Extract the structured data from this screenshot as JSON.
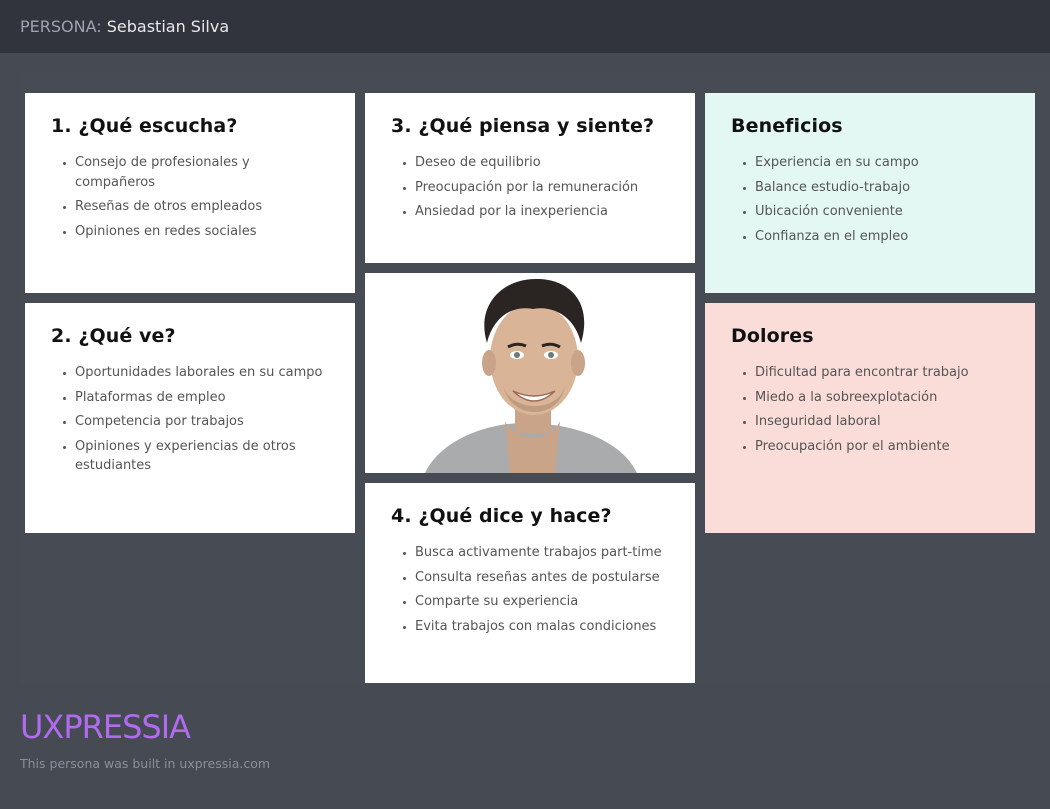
{
  "header": {
    "label": "PERSONA:",
    "name": "Sebastian Silva"
  },
  "cards": {
    "hears": {
      "title": "1. ¿Qué escucha?",
      "items": [
        "Consejo de profesionales y compañeros",
        "Reseñas de otros empleados",
        "Opiniones en redes sociales"
      ]
    },
    "sees": {
      "title": "2. ¿Qué ve?",
      "items": [
        "Oportunidades laborales en su campo",
        "Plataformas de empleo",
        "Competencia por trabajos",
        "Opiniones y experiencias de otros estudiantes"
      ]
    },
    "thinks": {
      "title": "3. ¿Qué piensa y siente?",
      "items": [
        "Deseo de equilibrio",
        "Preocupación por la remuneración",
        "Ansiedad por la inexperiencia"
      ]
    },
    "says": {
      "title": "4. ¿Qué dice y hace?",
      "items": [
        "Busca activamente trabajos part-time",
        "Consulta reseñas antes de postularse",
        "Comparte su experiencia",
        "Evita trabajos con malas condiciones"
      ]
    },
    "gains": {
      "title": "Beneficios",
      "items": [
        "Experiencia en su campo",
        "Balance estudio-trabajo",
        "Ubicación conveniente",
        "Confianza en el empleo"
      ]
    },
    "pains": {
      "title": "Dolores",
      "items": [
        "Dificultad para encontrar trabajo",
        "Miedo a la sobreexplotación",
        "Inseguridad laboral",
        "Preocupación por el ambiente"
      ]
    }
  },
  "footer": {
    "logo": "UXPRESSIA",
    "note": "This persona was built in uxpressia.com"
  },
  "colors": {
    "gains_bg": "#e4f8f3",
    "pains_bg": "#fadcd9",
    "logo": "#b06bef"
  }
}
